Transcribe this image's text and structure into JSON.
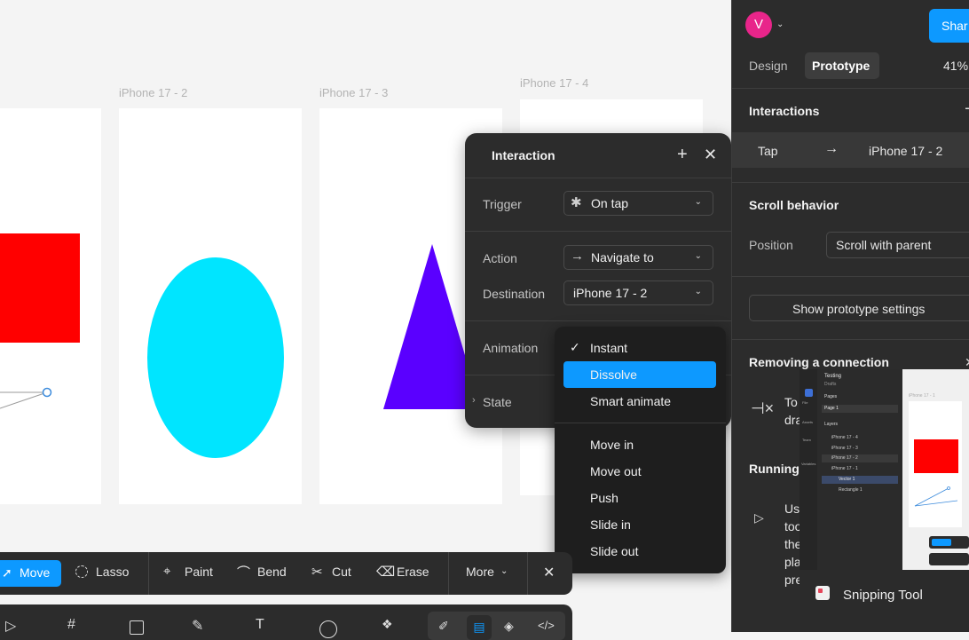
{
  "canvas": {
    "frames": [
      {
        "label": ""
      },
      {
        "label": "iPhone 17 - 2"
      },
      {
        "label": "iPhone 17 - 3"
      },
      {
        "label": "iPhone 17 - 4"
      }
    ],
    "colors": {
      "rect": "#ff0000",
      "ellipse": "#00e5ff",
      "triangle": "#5a00ff",
      "connector": "#3c8bdc"
    }
  },
  "panel": {
    "avatar_letter": "V",
    "avatar_color": "#e8258a",
    "share_label": "Shar",
    "tabs": [
      "Design",
      "Prototype"
    ],
    "zoom": "41%",
    "interactions_title": "Interactions",
    "interaction_row": {
      "trigger": "Tap",
      "target": "iPhone 17 - 2"
    },
    "scroll_title": "Scroll behavior",
    "position_label": "Position",
    "position_value": "Scroll with parent",
    "show_settings_label": "Show prototype settings",
    "removing_title": "Removing a connection",
    "removing_text_1": "To",
    "removing_text_2": "dra",
    "running_title": "Running",
    "running_text": [
      "Us",
      "too",
      "the",
      "pla",
      "pre"
    ]
  },
  "popup": {
    "title": "Interaction",
    "trigger_label": "Trigger",
    "trigger_value": "On tap",
    "action_label": "Action",
    "action_value": "Navigate to",
    "destination_label": "Destination",
    "destination_value": "iPhone 17 - 2",
    "animation_label": "Animation",
    "state_label": "State"
  },
  "dropdown": {
    "selected": "Instant",
    "highlighted": "Dissolve",
    "items_top": [
      "Instant",
      "Dissolve",
      "Smart animate"
    ],
    "items_bottom": [
      "Move in",
      "Move out",
      "Push",
      "Slide in",
      "Slide out"
    ],
    "highlight_color": "#0d99ff"
  },
  "toolbar": {
    "items": [
      "Move",
      "Lasso",
      "Paint",
      "Bend",
      "Cut",
      "Erase",
      "More"
    ],
    "active": "Move",
    "active_color": "#0d99ff"
  },
  "thumbnail": {
    "file": "Testing",
    "sub": "Drafts",
    "pages_label": "Pages",
    "page_item": "Page 1",
    "layers_label": "Layers",
    "layers": [
      "iPhone 17 - 4",
      "iPhone 17 - 3",
      "iPhone 17 - 2",
      "iPhone 17 - 1",
      "Vector 1",
      "Rectangle 1"
    ],
    "frame_label": "iPhone 17 - 1",
    "side_labels": [
      "File",
      "Assets",
      "Team",
      "Variables"
    ]
  },
  "snipping_tool": {
    "label": "Snipping Tool"
  }
}
